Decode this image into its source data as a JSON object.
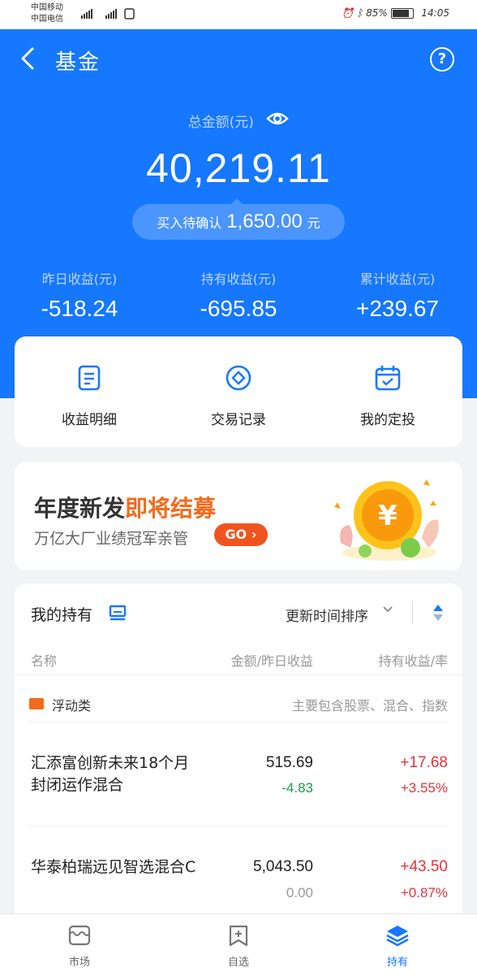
{
  "status_bar": {
    "carrier1": "中国移动",
    "carrier2": "中国电信",
    "net": "5G 46",
    "battery": "85%",
    "time": "14:05"
  },
  "header": {
    "title": "基金",
    "help_icon": "question-icon"
  },
  "summary": {
    "total_label": "总金额(元)",
    "total_value": "40,219.11",
    "pending_label": "买入待确认",
    "pending_value": "1,650.00",
    "pending_unit": "元",
    "stats": [
      {
        "label": "昨日收益(元)",
        "value": "-518.24"
      },
      {
        "label": "持有收益(元)",
        "value": "-695.85"
      },
      {
        "label": "累计收益(元)",
        "value": "+239.67"
      }
    ]
  },
  "quick_actions": [
    {
      "label": "收益明细",
      "icon": "document-icon"
    },
    {
      "label": "交易记录",
      "icon": "diamond-icon"
    },
    {
      "label": "我的定投",
      "icon": "calendar-icon"
    }
  ],
  "banner": {
    "title_a": "年度新发",
    "title_b": "即将结募",
    "subtitle": "万亿大厂业绩冠军亲管",
    "go_label": "GO"
  },
  "holdings": {
    "title": "我的持有",
    "sort_label": "更新时间排序",
    "col_name": "名称",
    "col_amount": "金额/昨日收益",
    "col_profit": "持有收益/率",
    "category": {
      "name": "浮动类",
      "desc": "主要包含股票、混合、指数"
    },
    "funds": [
      {
        "name": "汇添富创新未来18个月封闭运作混合",
        "amount": "515.69",
        "yesterday": "-4.83",
        "profit": "+17.68",
        "rate": "+3.55%"
      },
      {
        "name": "华泰柏瑞远见智选混合C",
        "amount": "5,043.50",
        "yesterday": "0.00",
        "profit": "+43.50",
        "rate": "+0.87%"
      }
    ]
  },
  "tabbar": [
    {
      "label": "市场",
      "icon": "market-icon"
    },
    {
      "label": "自选",
      "icon": "watchlist-icon"
    },
    {
      "label": "持有",
      "icon": "holdings-icon"
    }
  ],
  "colors": {
    "primary": "#1677ff",
    "up": "#e8333b",
    "down": "#1a9b4b",
    "accent": "#f36b1c"
  }
}
